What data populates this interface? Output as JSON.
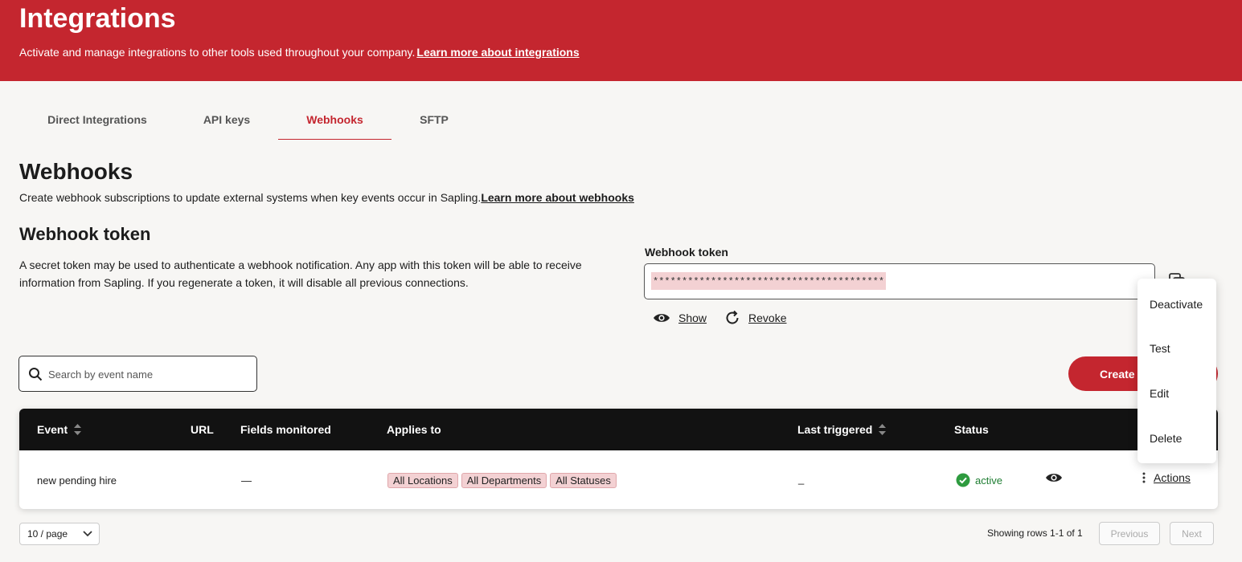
{
  "header": {
    "title": "Integrations",
    "subtitle": "Activate and manage integrations to other tools used throughout your company.",
    "subtitle_link": "Learn more about integrations",
    "color": "#c4262f"
  },
  "tabs": [
    {
      "label": "Direct Integrations",
      "active": false
    },
    {
      "label": "API keys",
      "active": false
    },
    {
      "label": "Webhooks",
      "active": true
    },
    {
      "label": "SFTP",
      "active": false
    }
  ],
  "section": {
    "title": "Webhooks",
    "description": "Create webhook subscriptions to update external systems when key events occur in Sapling.",
    "link": "Learn more about webhooks"
  },
  "token": {
    "title": "Webhook token",
    "description": "A secret token may be used to authenticate a webhook notification. Any app with this token will be able to receive information from Sapling. If you regenerate a token, it will disable all previous connections.",
    "field_label": "Webhook token",
    "value": "****************************************",
    "show_label": "Show",
    "revoke_label": "Revoke"
  },
  "search": {
    "placeholder": "Search by event name"
  },
  "create_button": "Create",
  "table": {
    "columns": {
      "event": "Event",
      "url": "URL",
      "fields": "Fields monitored",
      "applies": "Applies to",
      "last": "Last triggered",
      "status": "Status"
    },
    "rows": [
      {
        "event": "new pending hire",
        "url": "",
        "fields": "—",
        "tags": [
          "All Locations",
          "All Departments",
          "All Statuses"
        ],
        "last": "_",
        "status": "active",
        "actions": "Actions"
      }
    ]
  },
  "menu": {
    "items": [
      "Deactivate",
      "Test",
      "Edit",
      "Delete"
    ]
  },
  "pagination": {
    "page_size": "10 / page",
    "showing": "Showing rows 1-1 of 1",
    "previous": "Previous",
    "next": "Next"
  }
}
